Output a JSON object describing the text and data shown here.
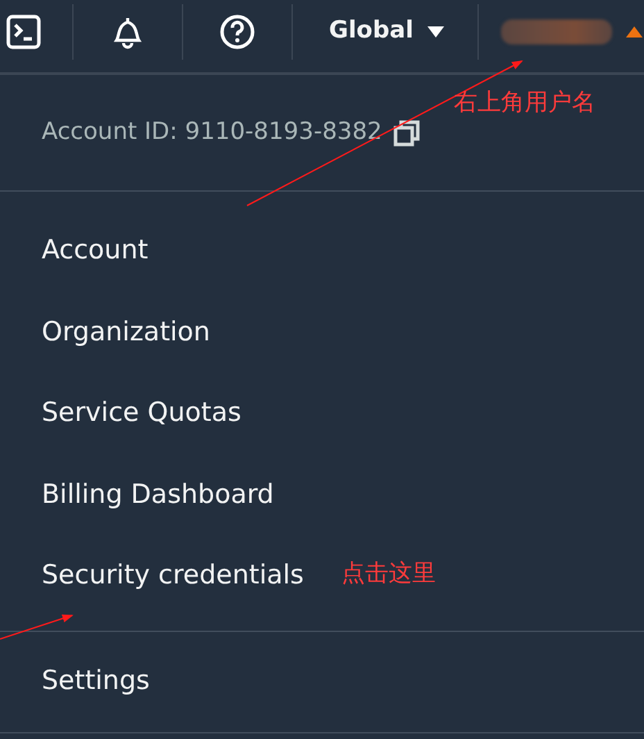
{
  "top_bar": {
    "region": "Global"
  },
  "account_id": "Account ID: 9110-8193-8382",
  "menu_items": [
    {
      "label": "Account"
    },
    {
      "label": "Organization"
    },
    {
      "label": "Service Quotas"
    },
    {
      "label": "Billing Dashboard"
    },
    {
      "label": "Security credentials"
    }
  ],
  "footer_items": [
    {
      "label": "Settings"
    }
  ],
  "annotations": [
    {
      "text": "右上角用户名"
    },
    {
      "text": "点击这里"
    }
  ]
}
